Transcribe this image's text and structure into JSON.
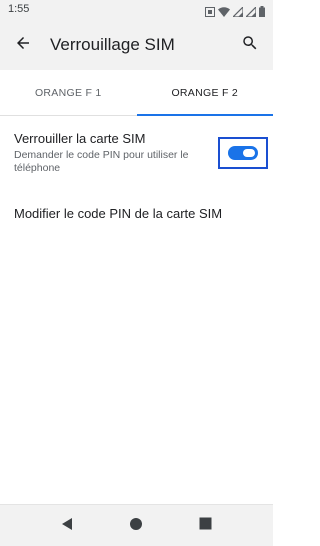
{
  "status_bar": {
    "time": "1:55",
    "icons": [
      "screenshot-icon",
      "wifi-icon",
      "signal-icon",
      "signal-icon",
      "battery-icon"
    ]
  },
  "app_bar": {
    "title": "Verrouillage SIM",
    "back_icon": "arrow-back-icon",
    "search_icon": "search-icon"
  },
  "tabs": [
    {
      "label": "ORANGE F 1",
      "selected": false
    },
    {
      "label": "ORANGE F 2",
      "selected": true
    }
  ],
  "settings": {
    "lock_sim": {
      "title": "Verrouiller la carte SIM",
      "summary": "Demander le code PIN pour utiliser le téléphone",
      "enabled": true
    },
    "change_pin": {
      "title": "Modifier le code PIN de la carte SIM"
    }
  },
  "nav_bar": {
    "buttons": [
      "back-triangle-icon",
      "home-circle-icon",
      "recents-square-icon"
    ]
  },
  "colors": {
    "accent": "#1a73e8",
    "focus_outline": "#1a4fd1",
    "bar_background": "#f2f2f2"
  }
}
